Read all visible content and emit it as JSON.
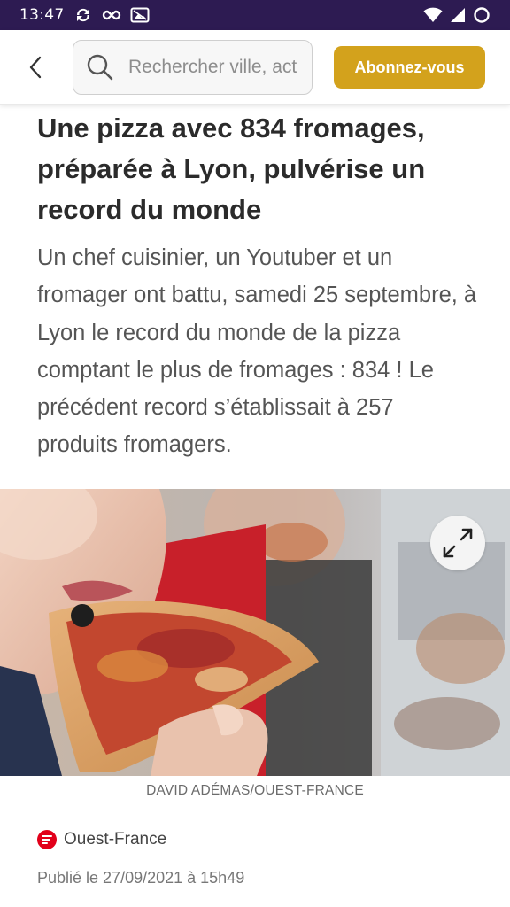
{
  "status_bar": {
    "time": "13:47"
  },
  "header": {
    "back_icon": "chevron-left-icon",
    "search": {
      "placeholder": "Rechercher ville, actualité",
      "value": ""
    },
    "subscribe_label": "Abonnez-vous",
    "subscribe_color": "#d3a21c"
  },
  "article": {
    "title": "Une pizza avec 834 fromages, préparée à Lyon, pulvérise un record du monde",
    "lead": "Un chef cuisinier, un Youtuber et un fromager ont battu, samedi 25 septembre, à Lyon le record du monde de la pizza comptant le plus de fromages : 834 ! Le précédent record s’établissait à 257 produits fromagers.",
    "image_credit": "DAVID ADÉMAS/OUEST-FRANCE",
    "source": "Ouest-France",
    "published": "Publié le 27/09/2021 à 15h49"
  },
  "colors": {
    "status_bar_bg": "#2d1b52",
    "brand_red": "#e2001a"
  }
}
